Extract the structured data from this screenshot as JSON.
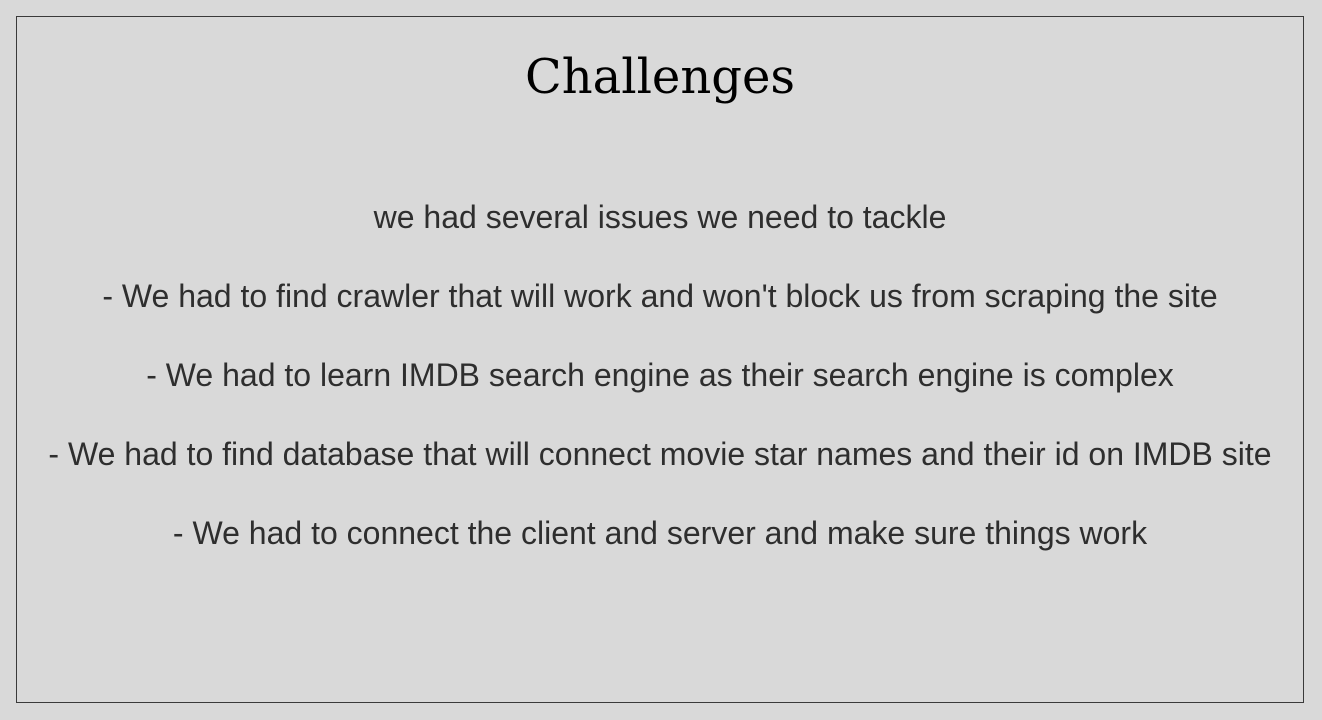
{
  "slide": {
    "title": "Challenges",
    "lines": [
      "we had several issues we need to tackle",
      "- We had to find crawler that will work and won't block us from scraping the site",
      "- We had to learn IMDB search engine as their search engine is complex",
      "- We had to find database that will connect movie star names and their id on IMDB site",
      "- We had to connect the client and server and make sure things work"
    ]
  },
  "colors": {
    "background": "#d9d9d9",
    "border": "#3a3a3a",
    "title_text": "#000000",
    "body_text": "#2e2e2e"
  }
}
